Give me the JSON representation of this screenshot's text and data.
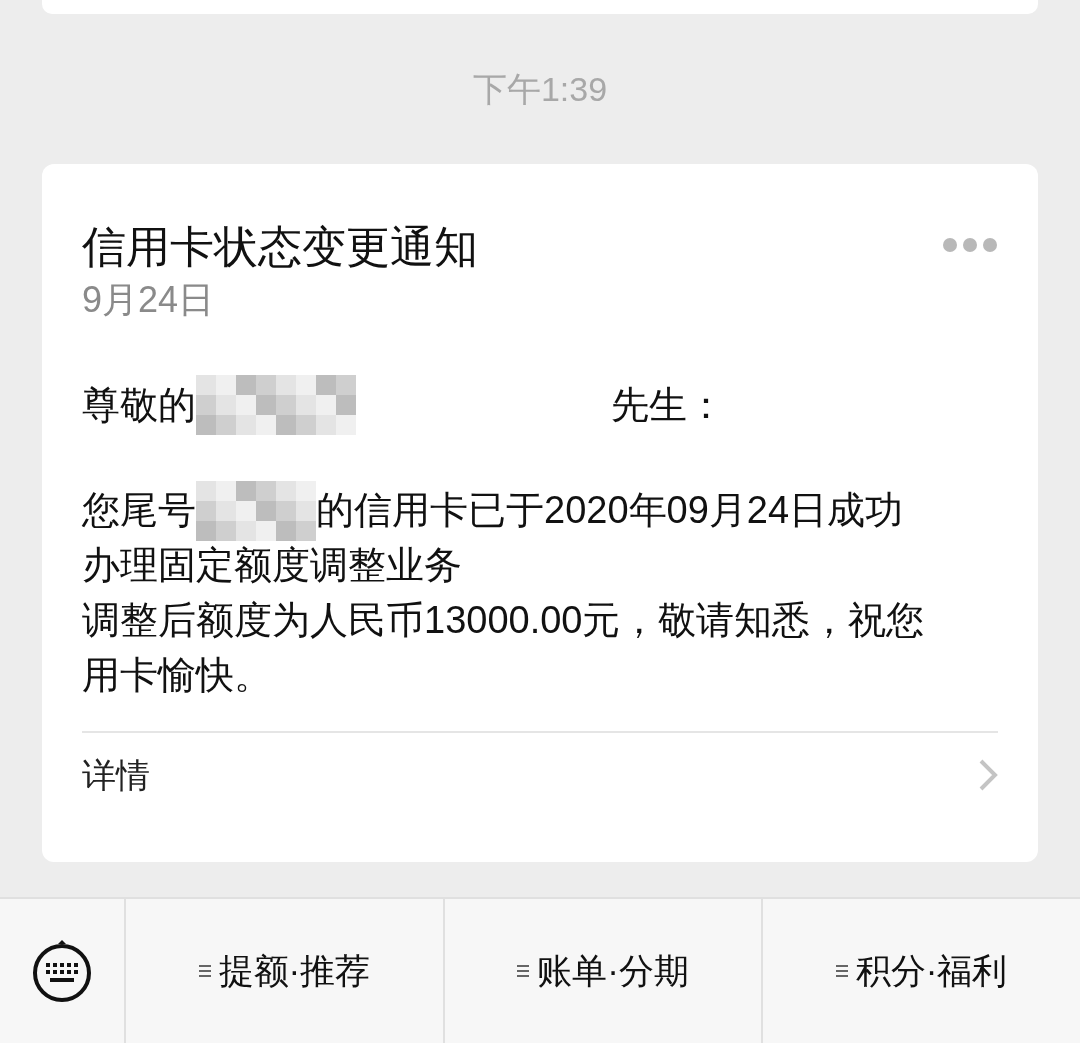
{
  "time": "下午1:39",
  "card": {
    "title": "信用卡状态变更通知",
    "date": "9月24日",
    "greeting_prefix": "尊敬的",
    "greeting_suffix": "先生：",
    "body_prefix": "您尾号",
    "body_rest": "的信用卡已于2020年09月24日成功",
    "body_lines": [
      "办理固定额度调整业务",
      "调整后额度为人民币13000.00元，敬请知悉，祝您用卡愉快。"
    ],
    "details_label": "详情"
  },
  "menu": [
    {
      "label": "提额·推荐"
    },
    {
      "label": "账单·分期"
    },
    {
      "label": "积分·福利"
    }
  ]
}
